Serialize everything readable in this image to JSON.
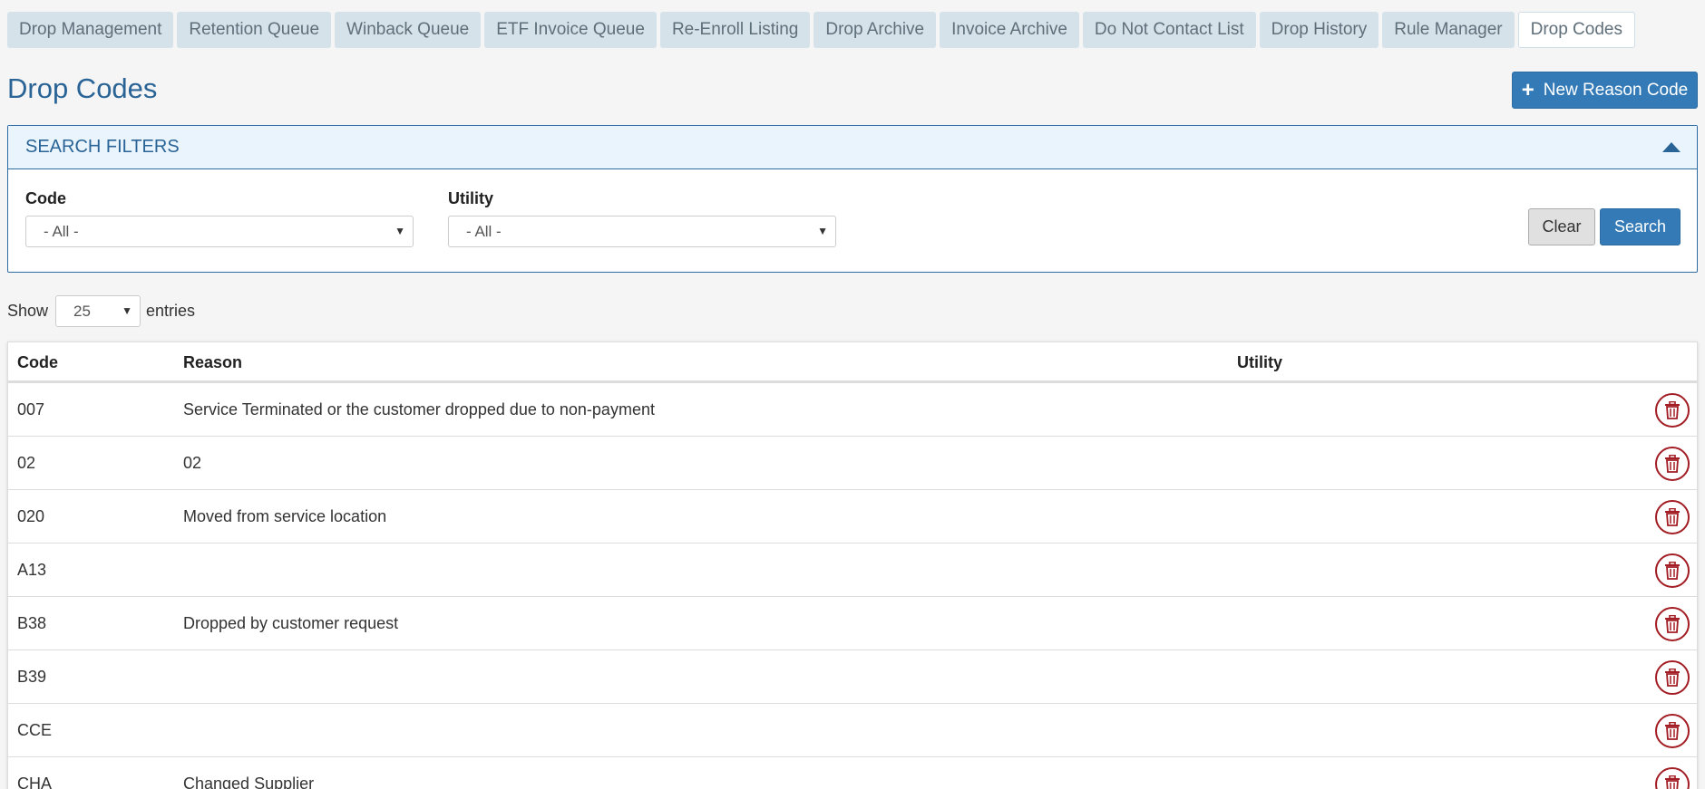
{
  "tabs": [
    {
      "label": "Drop Management",
      "active": false
    },
    {
      "label": "Retention Queue",
      "active": false
    },
    {
      "label": "Winback Queue",
      "active": false
    },
    {
      "label": "ETF Invoice Queue",
      "active": false
    },
    {
      "label": "Re-Enroll Listing",
      "active": false
    },
    {
      "label": "Drop Archive",
      "active": false
    },
    {
      "label": "Invoice Archive",
      "active": false
    },
    {
      "label": "Do Not Contact List",
      "active": false
    },
    {
      "label": "Drop History",
      "active": false
    },
    {
      "label": "Rule Manager",
      "active": false
    },
    {
      "label": "Drop Codes",
      "active": true
    }
  ],
  "page": {
    "title": "Drop Codes",
    "new_button_label": "New Reason Code"
  },
  "filters": {
    "title": "SEARCH FILTERS",
    "code_label": "Code",
    "code_value": "- All -",
    "utility_label": "Utility",
    "utility_value": "- All -",
    "clear_label": "Clear",
    "search_label": "Search"
  },
  "length": {
    "show_label": "Show",
    "value": "25",
    "entries_label": "entries"
  },
  "table": {
    "headers": {
      "code": "Code",
      "reason": "Reason",
      "utility": "Utility"
    },
    "rows": [
      {
        "code": "007",
        "reason": "Service Terminated or the customer dropped due to non-payment",
        "utility": ""
      },
      {
        "code": "02",
        "reason": "02",
        "utility": ""
      },
      {
        "code": "020",
        "reason": "Moved from service location",
        "utility": ""
      },
      {
        "code": "A13",
        "reason": "",
        "utility": ""
      },
      {
        "code": "B38",
        "reason": "Dropped by customer request",
        "utility": ""
      },
      {
        "code": "B39",
        "reason": "",
        "utility": ""
      },
      {
        "code": "CCE",
        "reason": "",
        "utility": ""
      },
      {
        "code": "CHA",
        "reason": "Changed Supplier",
        "utility": ""
      }
    ]
  },
  "colors": {
    "primary": "#337ab7",
    "title": "#2a6496",
    "danger": "#a31d24",
    "tab_bg": "#d5e2ea"
  }
}
